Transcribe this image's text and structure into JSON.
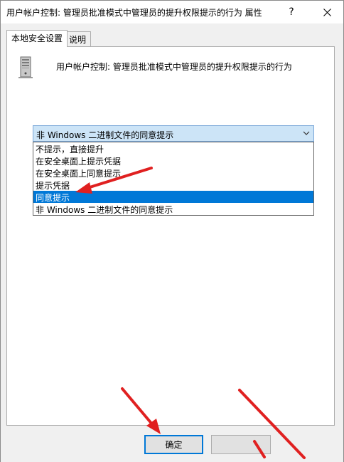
{
  "window": {
    "title": "用户帐户控制: 管理员批准模式中管理员的提升权限提示的行为 属性",
    "help_label": "?"
  },
  "tabs": [
    {
      "label": "本地安全设置",
      "active": true
    },
    {
      "label": "说明",
      "active": false
    }
  ],
  "policy": {
    "icon": "server-icon",
    "title": "用户帐户控制: 管理员批准模式中管理员的提升权限提示的行为"
  },
  "select": {
    "value": "非 Windows 二进制文件的同意提示",
    "options": [
      "不提示，直接提升",
      "在安全桌面上提示凭据",
      "在安全桌面上同意提示",
      "提示凭据",
      "同意提示",
      "非 Windows 二进制文件的同意提示"
    ],
    "highlighted": "同意提示"
  },
  "buttons": {
    "ok_label": "确定",
    "cancel_label": ""
  },
  "colors": {
    "selection": "#0078d7",
    "select_bg": "#cce4f7",
    "annotation_arrow": "#e02020"
  }
}
